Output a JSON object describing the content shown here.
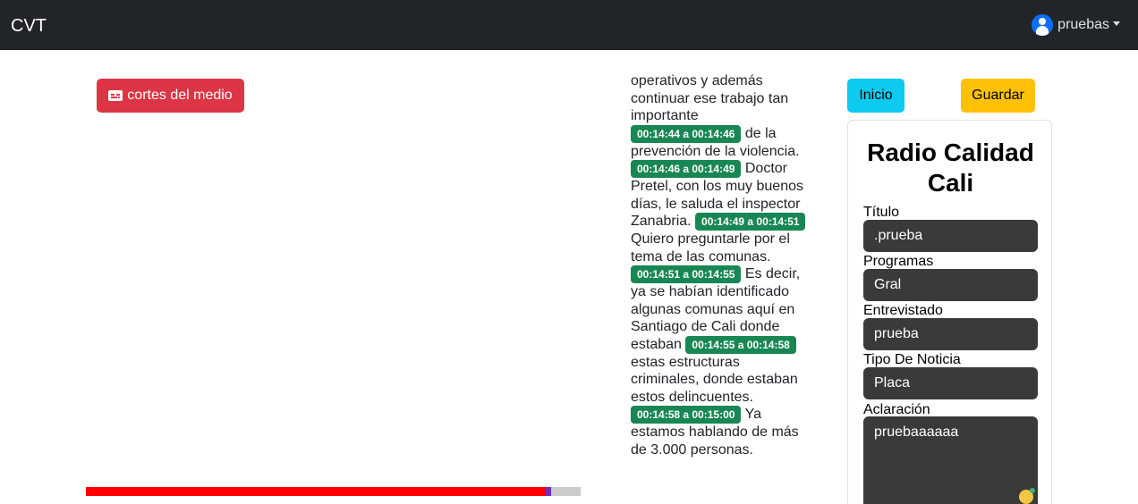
{
  "navbar": {
    "brand": "CVT",
    "username": "pruebas",
    "user_icon": "user-circle-icon",
    "dropdown_icon": "caret-down-icon"
  },
  "actions": {
    "cortes_label": "cortes del medio",
    "cortes_icon": "closed-captions-icon",
    "inicio_label": "Inicio",
    "guardar_label": "Guardar"
  },
  "colors": {
    "navbar": "#212529",
    "danger": "#dc3545",
    "info": "#0dcaf0",
    "warning": "#ffc107",
    "timestamp_badge": "#198754",
    "progress_played": "#ff0000",
    "progress_track": "#cccccc",
    "input_bg": "#3a3a3a"
  },
  "player": {
    "progress_fraction": 0.94
  },
  "transcript": {
    "intro": "operativos y además continuar ese trabajo tan importante",
    "segments": [
      {
        "time": "00:14:44 a 00:14:46",
        "text": "de la prevención de la violencia."
      },
      {
        "time": "00:14:46 a 00:14:49",
        "text": "Doctor Pretel, con los muy buenos días, le saluda el inspector Zanabria."
      },
      {
        "time": "00:14:49 a 00:14:51",
        "text": "Quiero preguntarle por el tema de las comunas."
      },
      {
        "time": "00:14:51 a 00:14:55",
        "text": "Es decir, ya se habían identificado algunas comunas aquí en Santiago de Cali donde estaban"
      },
      {
        "time": "00:14:55 a 00:14:58",
        "text": "estas estructuras criminales, donde estaban estos delincuentes."
      },
      {
        "time": "00:14:58 a 00:15:00",
        "text": "Ya estamos hablando de más de 3.000 personas."
      }
    ]
  },
  "form": {
    "title": "Radio Calidad Cali",
    "titulo_label": "Título",
    "titulo_value": ".prueba",
    "programas_label": "Programas",
    "programas_value": "Gral",
    "entrevistado_label": "Entrevistado",
    "entrevistado_value": "prueba",
    "tipo_label": "Tipo De Noticia",
    "tipo_value": "Placa",
    "aclaracion_label": "Aclaración",
    "aclaracion_value": "pruebaaaaaa",
    "grammar_icon": "grammar-assistant-icon"
  }
}
